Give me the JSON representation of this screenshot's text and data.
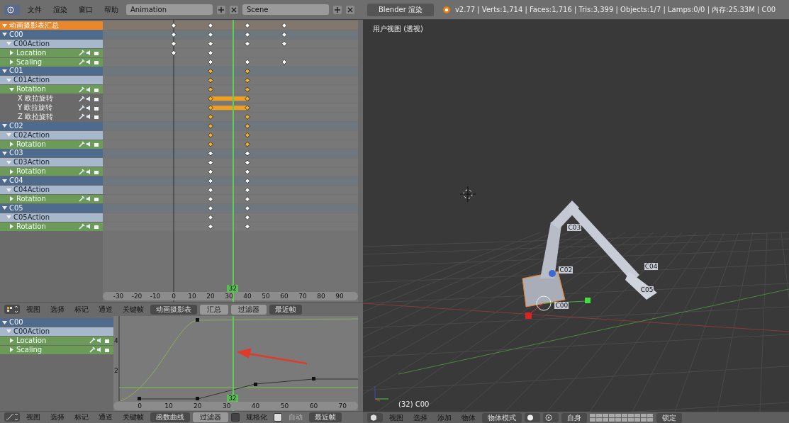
{
  "top_bar": {
    "menus": [
      "文件",
      "渲染",
      "窗口",
      "帮助"
    ],
    "layout": "Animation",
    "scene": "Scene",
    "engine": "Blender 渲染",
    "stats": "v2.77 | Verts:1,714 | Faces:1,716 | Tris:3,399 | Objects:1/7 | Lamps:0/0 | 内存:25.33M | C00"
  },
  "dope_sheet": {
    "channels": [
      {
        "kind": "summary",
        "label": "动画摄影表汇总",
        "expanded": true,
        "keys_selected": false
      },
      {
        "kind": "object",
        "label": "C00",
        "expanded": true,
        "keys_selected": false
      },
      {
        "kind": "action",
        "label": "C00Action",
        "expanded": true,
        "keys_selected": false
      },
      {
        "kind": "group",
        "label": "Location",
        "expanded": false,
        "keys_selected": false
      },
      {
        "kind": "group",
        "label": "Scaling",
        "expanded": false,
        "keys_selected": false
      },
      {
        "kind": "object",
        "label": "C01",
        "expanded": true,
        "keys_selected": true
      },
      {
        "kind": "action",
        "label": "C01Action",
        "expanded": true,
        "keys_selected": true
      },
      {
        "kind": "group",
        "label": "Rotation",
        "expanded": true,
        "keys_selected": true
      },
      {
        "kind": "fcurve",
        "label": "X 欧拉旋转",
        "keys_selected": true
      },
      {
        "kind": "fcurve",
        "label": "Y 欧拉旋转",
        "keys_selected": true
      },
      {
        "kind": "fcurve",
        "label": "Z 欧拉旋转",
        "keys_selected": true
      },
      {
        "kind": "object",
        "label": "C02",
        "expanded": true,
        "keys_selected": true
      },
      {
        "kind": "action",
        "label": "C02Action",
        "expanded": true,
        "keys_selected": true
      },
      {
        "kind": "group",
        "label": "Rotation",
        "expanded": false,
        "keys_selected": true
      },
      {
        "kind": "object",
        "label": "C03",
        "expanded": true,
        "keys_selected": false
      },
      {
        "kind": "action",
        "label": "C03Action",
        "expanded": true,
        "keys_selected": false
      },
      {
        "kind": "group",
        "label": "Rotation",
        "expanded": false,
        "keys_selected": false
      },
      {
        "kind": "object",
        "label": "C04",
        "expanded": true,
        "keys_selected": false
      },
      {
        "kind": "action",
        "label": "C04Action",
        "expanded": true,
        "keys_selected": false
      },
      {
        "kind": "group",
        "label": "Rotation",
        "expanded": false,
        "keys_selected": false
      },
      {
        "kind": "object",
        "label": "C05",
        "expanded": true,
        "keys_selected": false
      },
      {
        "kind": "action",
        "label": "C05Action",
        "expanded": true,
        "keys_selected": false
      },
      {
        "kind": "group",
        "label": "Rotation",
        "expanded": false,
        "keys_selected": false
      }
    ],
    "ruler_labels": [
      "-30",
      "-20",
      "-10",
      "0",
      "10",
      "20",
      "30",
      "40",
      "50",
      "60",
      "70",
      "80",
      "90"
    ],
    "current_frame": "32"
  },
  "dope_header": {
    "menus": [
      "视图",
      "选择",
      "标记",
      "通道",
      "关键帧"
    ],
    "mode": "动画摄影表",
    "summary": "汇总",
    "filter": "过滤器",
    "snap": "最近帧"
  },
  "graph_editor": {
    "channels": [
      {
        "kind": "object",
        "label": "C00",
        "expanded": true
      },
      {
        "kind": "action",
        "label": "C00Action",
        "expanded": true
      },
      {
        "kind": "group",
        "label": "Location",
        "expanded": false
      },
      {
        "kind": "group",
        "label": "Scaling",
        "expanded": false
      }
    ],
    "y_labels": [
      "4",
      "2"
    ],
    "x_labels": [
      "0",
      "10",
      "20",
      "30",
      "40",
      "50",
      "60",
      "70"
    ],
    "current_frame": "32"
  },
  "graph_header": {
    "menus": [
      "视图",
      "选择",
      "标记",
      "通道",
      "关键帧"
    ],
    "mode": "函数曲线",
    "filter": "过滤器",
    "normalize": "规格化",
    "normalize_on": false,
    "auto": "自动",
    "auto_on": true,
    "snap": "最近帧"
  },
  "viewport": {
    "title": "用户视图 (透视)",
    "object_labels": [
      "C03",
      "C02",
      "C04",
      "C05",
      "C00"
    ],
    "info": "(32) C00"
  },
  "view_header": {
    "menus": [
      "视图",
      "选择",
      "添加",
      "物体"
    ],
    "mode": "物体模式",
    "orientation": "自身",
    "lock": "锁定"
  }
}
